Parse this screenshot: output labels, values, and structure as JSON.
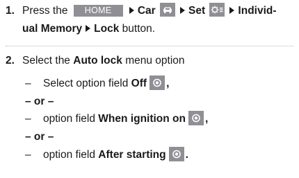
{
  "step1": {
    "number": "1.",
    "press": "Press the",
    "home_key": "HOME",
    "car": "Car",
    "set": "Set",
    "individ": "Individ-",
    "ual_memory": "ual Memory",
    "lock": "Lock",
    "button": "button.",
    "icons": [
      "car-icon",
      "settings-icon"
    ]
  },
  "step2": {
    "number": "2.",
    "select": "Select the",
    "auto_lock": "Auto lock",
    "menu_option": "menu option",
    "dash": "–",
    "opt1_prefix": "Select option field",
    "opt1_value": "Off",
    "opt1_suffix": ",",
    "or1": "– or –",
    "opt2_prefix": "option field",
    "opt2_value": "When ignition on",
    "opt2_suffix": ",",
    "or2": "– or –",
    "opt3_prefix": "option field",
    "opt3_value": "After starting",
    "opt3_suffix": ".",
    "radio_icon": "radio-selected-icon"
  },
  "colors": {
    "icon_bg": "#8f8f95",
    "text": "#1a1a1a",
    "divider": "#b8b8b8"
  }
}
